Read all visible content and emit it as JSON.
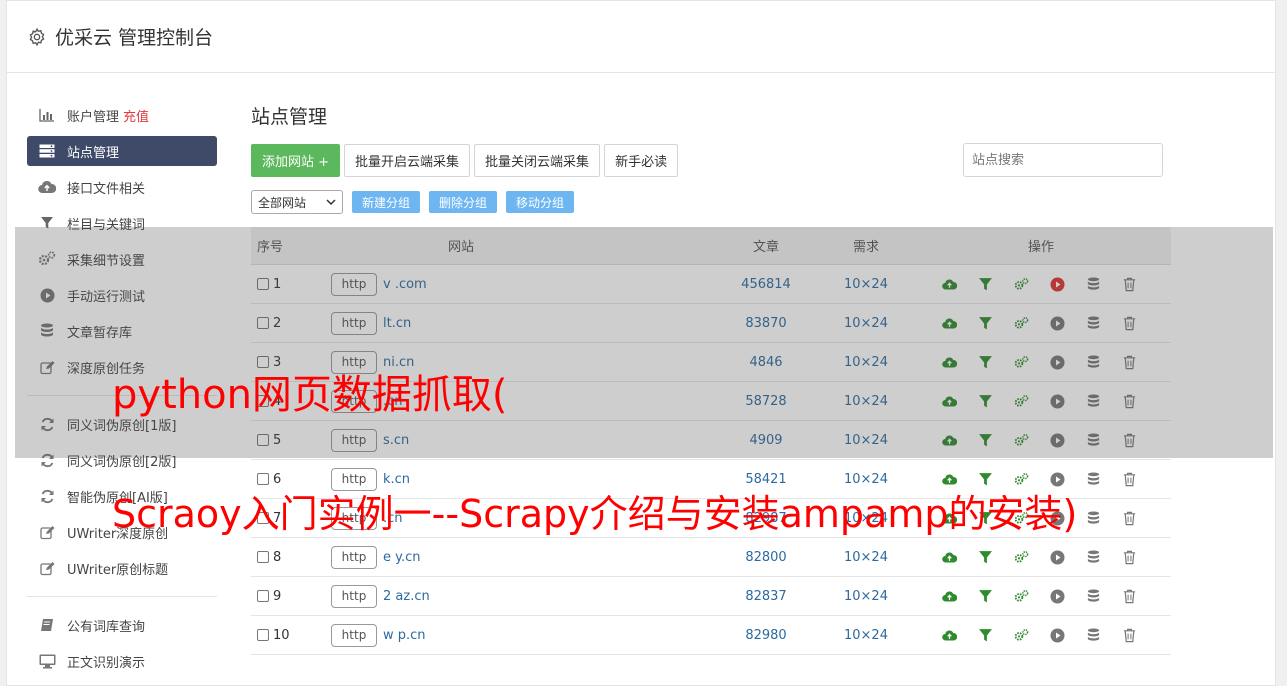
{
  "header": {
    "title": "优采云 管理控制台"
  },
  "sidebar": {
    "items": [
      {
        "label": "账户管理",
        "badge": "充值",
        "icon": "bar-chart-icon"
      },
      {
        "label": "站点管理",
        "icon": "server-icon",
        "active": true
      },
      {
        "label": "接口文件相关",
        "icon": "cloud-upload-icon"
      },
      {
        "label": "栏目与关键词",
        "icon": "filter-icon"
      },
      {
        "label": "采集细节设置",
        "icon": "gears-icon"
      },
      {
        "label": "手动运行测试",
        "icon": "play-circle-icon"
      },
      {
        "label": "文章暂存库",
        "icon": "database-icon"
      },
      {
        "label": "深度原创任务",
        "icon": "edit-icon"
      },
      {
        "label": "同义词伪原创[1版]",
        "icon": "refresh-icon"
      },
      {
        "label": "同义词伪原创[2版]",
        "icon": "refresh-icon"
      },
      {
        "label": "智能伪原创[AI版]",
        "icon": "refresh-icon"
      },
      {
        "label": "UWriter深度原创",
        "icon": "edit-icon"
      },
      {
        "label": "UWriter原创标题",
        "icon": "edit-icon"
      },
      {
        "label": "公有词库查询",
        "icon": "book-icon"
      },
      {
        "label": "正文识别演示",
        "icon": "monitor-icon"
      }
    ]
  },
  "main": {
    "title": "站点管理",
    "toolbar": {
      "add_site": "添加网站 +",
      "batch_open": "批量开启云端采集",
      "batch_close": "批量关闭云端采集",
      "newbie": "新手必读",
      "search_placeholder": "站点搜索"
    },
    "group_select": "全部网站",
    "group_buttons": {
      "new": "新建分组",
      "delete": "删除分组",
      "move": "移动分组"
    },
    "table": {
      "headers": {
        "no": "序号",
        "site": "网站",
        "articles": "文章",
        "demand": "需求",
        "ops": "操作"
      },
      "rows": [
        {
          "no": "1",
          "protocol": "http",
          "domain": "v          .com",
          "articles": "456814",
          "demand": "10×24",
          "running": true
        },
        {
          "no": "2",
          "protocol": "http",
          "domain": "     lt.cn",
          "articles": "83870",
          "demand": "10×24",
          "running": false
        },
        {
          "no": "3",
          "protocol": "http",
          "domain": "     ni.cn",
          "articles": "4846",
          "demand": "10×24",
          "running": false
        },
        {
          "no": "4",
          "protocol": "http",
          "domain": "     .cn",
          "articles": "58728",
          "demand": "10×24",
          "running": false
        },
        {
          "no": "5",
          "protocol": "http",
          "domain": "     s.cn",
          "articles": "4909",
          "demand": "10×24",
          "running": false
        },
        {
          "no": "6",
          "protocol": "http",
          "domain": "     k.cn",
          "articles": "58421",
          "demand": "10×24",
          "running": false
        },
        {
          "no": "7",
          "protocol": "http",
          "domain": "     .cn",
          "articles": "82987",
          "demand": "10×24",
          "running": false
        },
        {
          "no": "8",
          "protocol": "http",
          "domain": "e    y.cn",
          "articles": "82800",
          "demand": "10×24",
          "running": false
        },
        {
          "no": "9",
          "protocol": "http",
          "domain": "2    az.cn",
          "articles": "82837",
          "demand": "10×24",
          "running": false
        },
        {
          "no": "10",
          "protocol": "http",
          "domain": "w    p.cn",
          "articles": "82980",
          "demand": "10×24",
          "running": false
        }
      ]
    }
  },
  "watermark": {
    "line1": "python网页数据抓取(",
    "line2": "Scraoy入门实例一--Scrapy介绍与安装ampamp的安装)"
  },
  "colors": {
    "accent_green": "#5cb85c",
    "sidebar_active": "#3e4a68",
    "link_blue": "#2c6aa0",
    "watermark_red": "#ff0000"
  }
}
